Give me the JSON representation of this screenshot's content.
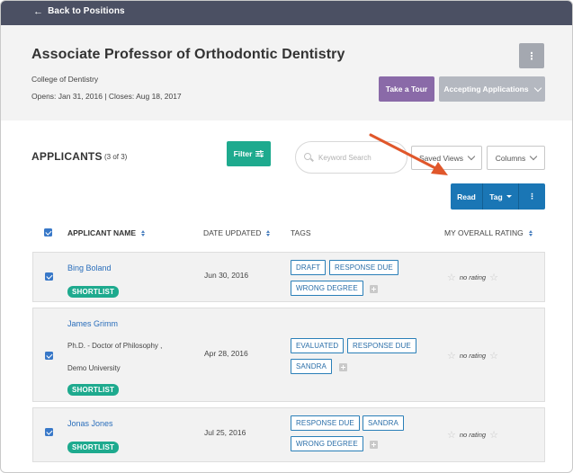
{
  "nav": {
    "back_label": "Back to Positions"
  },
  "position": {
    "title": "Associate Professor of Orthodontic Dentistry",
    "college": "College of Dentistry",
    "dates": "Opens: Jan 31, 2016  |  Closes: Aug 18, 2017",
    "more_label": "⋮",
    "tour_label": "Take a Tour",
    "status_label": "Accepting Applications"
  },
  "applicants": {
    "heading": "APPLICANTS",
    "count": "(3 of 3)",
    "filter_label": "Filter",
    "search_placeholder": "Keyword Search",
    "saved_views_label": "Saved Views",
    "columns_label": "Columns",
    "bulk_actions": {
      "read": "Read",
      "tag": "Tag",
      "more": "⋮"
    }
  },
  "table": {
    "headers": {
      "name": "APPLICANT NAME",
      "date": "DATE UPDATED",
      "tags": "TAGS",
      "rating": "MY OVERALL RATING"
    },
    "rows": [
      {
        "name": "Bing Boland",
        "degree": "",
        "school": "",
        "badge": "SHORTLIST",
        "date": "Jun 30, 2016",
        "tags": [
          "DRAFT",
          "RESPONSE DUE",
          "WRONG DEGREE"
        ],
        "rating": "no rating",
        "checked": true
      },
      {
        "name": "James Grimm",
        "degree": "Ph.D. - Doctor of Philosophy ,",
        "school": "Demo University",
        "badge": "SHORTLIST",
        "date": "Apr 28, 2016",
        "tags": [
          "EVALUATED",
          "RESPONSE DUE",
          "SANDRA"
        ],
        "rating": "no rating",
        "checked": true
      },
      {
        "name": "Jonas Jones",
        "degree": "",
        "school": "",
        "badge": "SHORTLIST",
        "date": "Jul 25, 2016",
        "tags": [
          "RESPONSE DUE",
          "SANDRA",
          "WRONG DEGREE"
        ],
        "rating": "no rating",
        "checked": true
      }
    ]
  },
  "colors": {
    "topbar": "#4b5063",
    "accent_green": "#1eaa8e",
    "accent_blue": "#1a76b5",
    "tour_purple": "#8a6aa8",
    "annotation_arrow": "#e0572b"
  }
}
